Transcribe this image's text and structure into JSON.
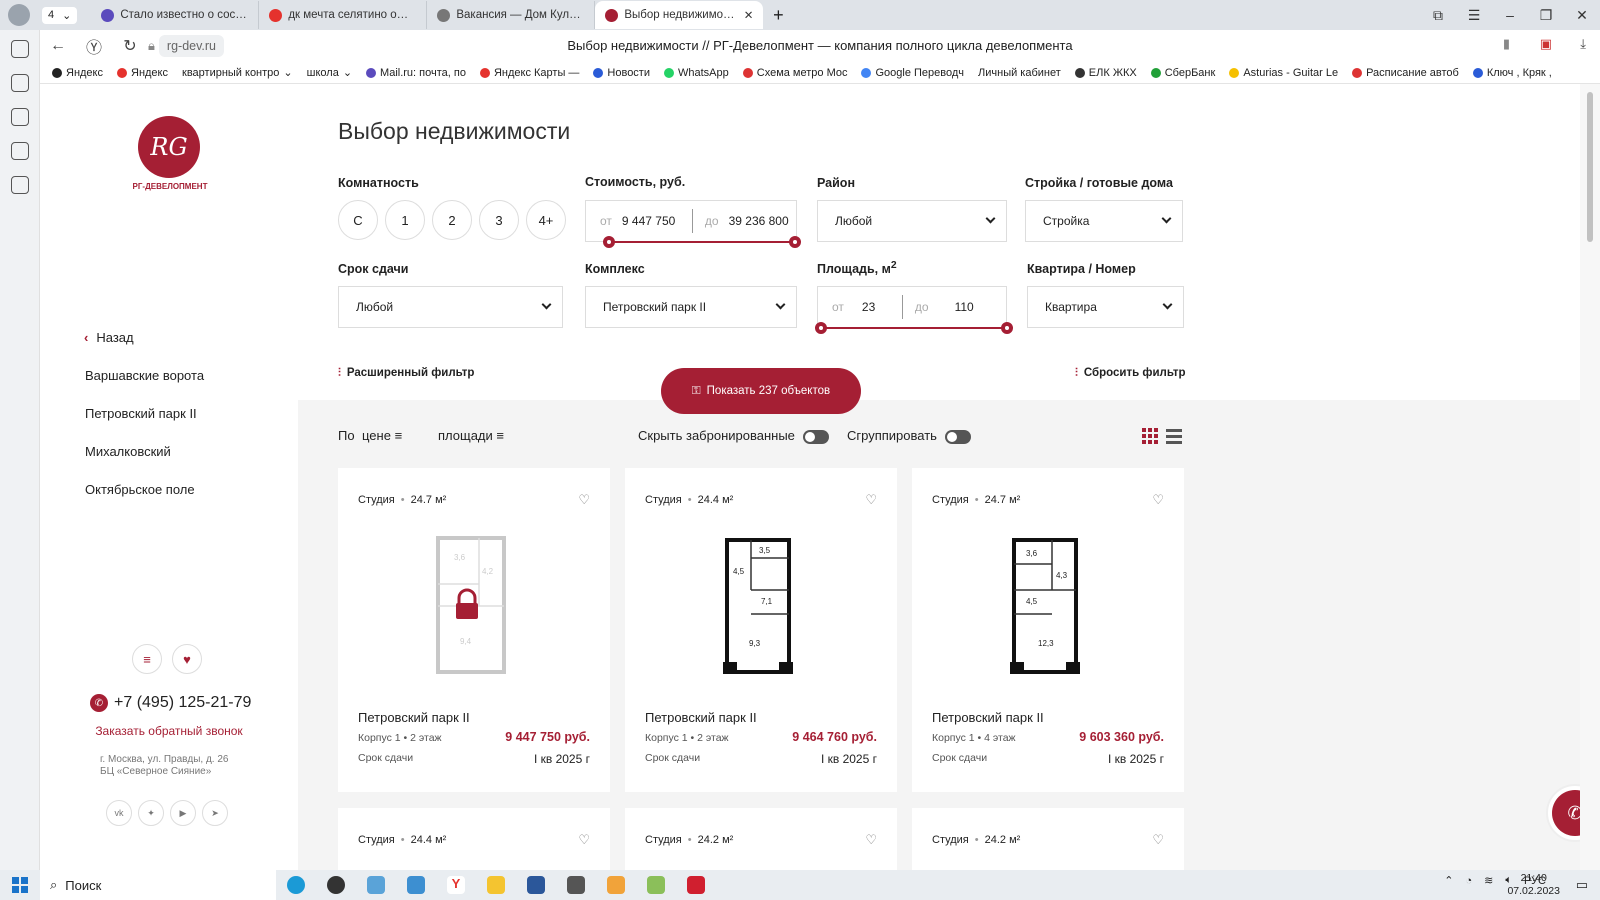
{
  "browser": {
    "tab_count": "4",
    "tabs": [
      {
        "label": "Стало известно о состоян",
        "color": "#5b4bbd"
      },
      {
        "label": "дк мечта селятино офици",
        "color": "#e5322d"
      },
      {
        "label": "Вакансия — Дом Культур",
        "color": "#777777"
      },
      {
        "label": "Выбор недвижимости",
        "color": "#a51f34"
      }
    ],
    "url": "rg-dev.ru",
    "page_title": "Выбор недвижимости // РГ-Девелопмент — компания полного цикла девелопмента",
    "bookmarks": [
      "Яндекс",
      "Яндекс",
      "квартирный контро",
      "школа",
      "Mail.ru: почта, по",
      "Яндекс Карты — ",
      "Новости",
      "WhatsApp",
      "Схема метро Мос",
      "Google Переводч",
      "Личный кабинет",
      "ЕЛК ЖКХ",
      "СберБанк",
      "Asturias - Guitar Le",
      "Расписание автоб",
      "Ключ , Кряк , "
    ]
  },
  "sidebar": {
    "logo_text": "RG",
    "logo_caption": "РГ-ДЕВЕЛОПМЕНТ",
    "back_label": "Назад",
    "nav": [
      "Варшавские ворота",
      "Петровский парк II",
      "Михалковский",
      "Октябрьское поле"
    ],
    "phone": "+7 (495) 125-21-79",
    "callback": "Заказать обратный звонок",
    "address_line1": "г. Москва, ул. Правды, д. 26",
    "address_line2": "БЦ «Северное Сияние»"
  },
  "filters": {
    "title": "Выбор недвижимости",
    "rooms_label": "Комнатность",
    "rooms": [
      "С",
      "1",
      "2",
      "3",
      "4+"
    ],
    "price_label": "Стоимость, руб.",
    "price_from_ph": "от",
    "price_from": "9 447 750",
    "price_to_ph": "до",
    "price_to": "39 236 800",
    "district_label": "Район",
    "district_value": "Любой",
    "build_label": "Стройка / готовые дома",
    "build_value": "Стройка",
    "deadline_label": "Срок сдачи",
    "deadline_value": "Любой",
    "complex_label": "Комплекс",
    "complex_value": "Петровский парк II",
    "area_label": "Площадь, м",
    "area_sup": "2",
    "area_from_ph": "от",
    "area_from": "23",
    "area_to_ph": "до",
    "area_to": "110",
    "apt_label": "Квартира / Номер",
    "apt_value": "Квартира",
    "extended": "Расширенный фильтр",
    "reset": "Сбросить фильтр",
    "show_button": "Показать 237 объектов"
  },
  "sort": {
    "by": "По",
    "price": "цене",
    "area": "площади",
    "hide_booked": "Скрыть забронированные",
    "group": "Сгруппировать"
  },
  "cards": [
    {
      "type": "Студия",
      "area": "24.7 м²",
      "name": "Петровский парк II",
      "building": "Корпус 1",
      "floor": "2 этаж",
      "price": "9 447 750 руб.",
      "deadline_label": "Срок сдачи",
      "deadline": "I кв 2025 г",
      "locked": true,
      "rooms": [
        "3,6",
        "4,2",
        "9,4"
      ]
    },
    {
      "type": "Студия",
      "area": "24.4 м²",
      "name": "Петровский парк II",
      "building": "Корпус 1",
      "floor": "2 этаж",
      "price": "9 464 760 руб.",
      "deadline_label": "Срок сдачи",
      "deadline": "I кв 2025 г",
      "locked": false,
      "rooms": [
        "3,5",
        "4,5",
        "7,1",
        "9,3"
      ]
    },
    {
      "type": "Студия",
      "area": "24.7 м²",
      "name": "Петровский парк II",
      "building": "Корпус 1",
      "floor": "4 этаж",
      "price": "9 603 360 руб.",
      "deadline_label": "Срок сдачи",
      "deadline": "I кв 2025 г",
      "locked": false,
      "rooms": [
        "3,6",
        "4,3",
        "4,5",
        "12,3"
      ]
    },
    {
      "type": "Студия",
      "area": "24.4 м²"
    },
    {
      "type": "Студия",
      "area": "24.2 м²"
    },
    {
      "type": "Студия",
      "area": "24.2 м²"
    }
  ],
  "taskbar": {
    "search": "Поиск",
    "lang": "РУС",
    "time": "21:40",
    "date": "07.02.2023"
  },
  "colors": {
    "accent": "#a51f34"
  }
}
